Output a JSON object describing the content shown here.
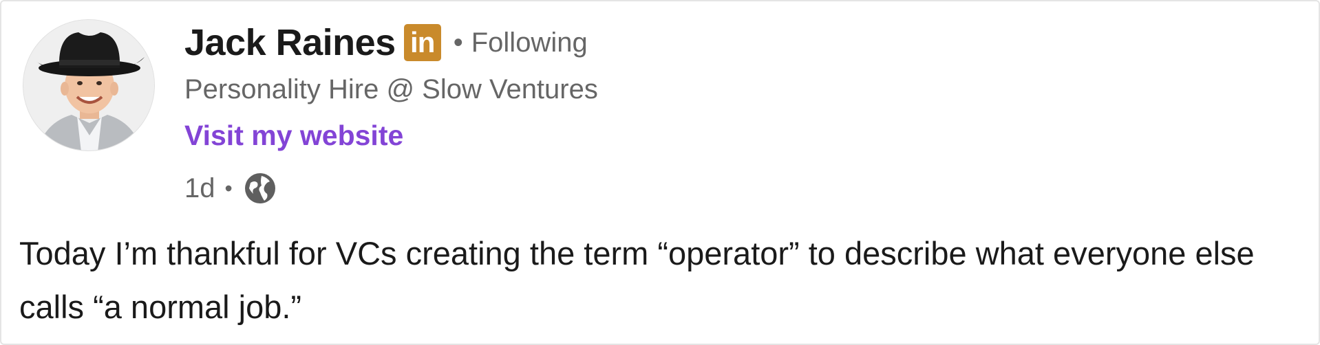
{
  "post": {
    "author": {
      "name": "Jack Raines",
      "headline": "Personality Hire @ Slow Ventures",
      "website_label": "Visit my website",
      "linkedin_badge_text": "in",
      "follow_status": "Following",
      "separator": "•"
    },
    "meta": {
      "timestamp": "1d",
      "separator": "•",
      "visibility_icon": "globe-icon"
    },
    "body": "Today I’m thankful for VCs creating the term “operator” to describe what everyone else calls “a normal job.”"
  },
  "colors": {
    "website_link": "#8344d6",
    "linkedin_badge": "#c98a2b",
    "muted_text": "#666666",
    "primary_text": "#1a1a1a"
  }
}
